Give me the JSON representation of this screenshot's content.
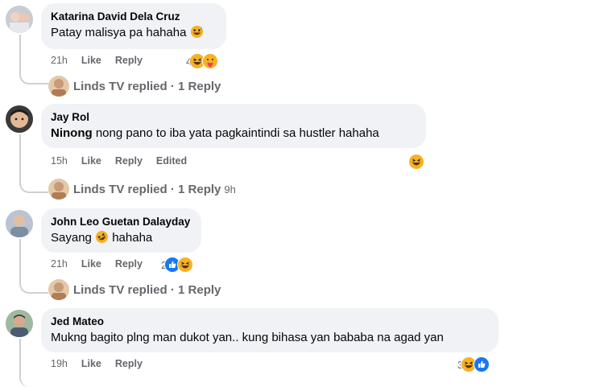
{
  "comments": [
    {
      "author": "Katarina David Dela Cruz",
      "text": "Patay malisya pa hahaha",
      "text_emoji": "grinning-sweat",
      "time": "21h",
      "like_label": "Like",
      "reply_label": "Reply",
      "reaction_count": "4",
      "reactions": [
        "haha-icon",
        "care-icon"
      ],
      "replied_text": "Linds TV replied · 1 Reply",
      "replied_ago": ""
    },
    {
      "author": "Jay Rol",
      "text_bold": "Ninong",
      "text": "nong pano to iba yata pagkaintindi sa hustler hahaha",
      "time": "15h",
      "like_label": "Like",
      "reply_label": "Reply",
      "edited_label": "Edited",
      "reaction_count": "",
      "reactions": [
        "haha-icon"
      ],
      "replied_text": "Linds TV replied · 1 Reply",
      "replied_ago": "9h"
    },
    {
      "author": "John Leo Guetan Dalayday",
      "text": "Sayang",
      "text_emoji": "rolling-laughing",
      "text_after": "hahaha",
      "time": "21h",
      "like_label": "Like",
      "reply_label": "Reply",
      "reaction_count": "2",
      "reactions": [
        "like-icon",
        "haha-icon"
      ],
      "replied_text": "Linds TV replied · 1 Reply",
      "replied_ago": ""
    },
    {
      "author": "Jed Mateo",
      "text": "Mukng bagito plng man dukot yan.. kung bihasa yan bababa na agad yan",
      "time": "19h",
      "like_label": "Like",
      "reply_label": "Reply",
      "reaction_count": "3",
      "reactions": [
        "haha-icon",
        "like-icon"
      ]
    }
  ],
  "colors": {
    "bubble": "#f0f2f5",
    "meta_text": "#65676b",
    "like_blue": "#1877f2",
    "haha_yellow": "#f7b125"
  }
}
